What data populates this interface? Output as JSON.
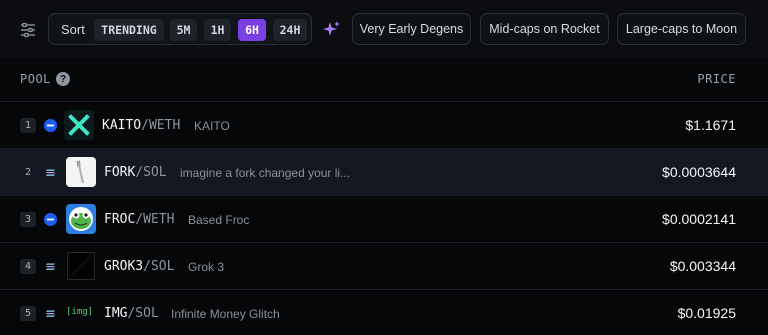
{
  "toolbar": {
    "sort_label": "Sort",
    "sort_options": [
      {
        "label": "TRENDING",
        "active": false
      },
      {
        "label": "5M",
        "active": false
      },
      {
        "label": "1H",
        "active": false
      },
      {
        "label": "6H",
        "active": true
      },
      {
        "label": "24H",
        "active": false
      }
    ],
    "presets": [
      "Very Early Degens",
      "Mid-caps on Rocket",
      "Large-caps to Moon"
    ],
    "accent_color": "#7b3fe4"
  },
  "table": {
    "pool_header": "POOL",
    "help_glyph": "?",
    "price_header": "PRICE",
    "rows": [
      {
        "rank": "1",
        "chain_icon": "base-chain-icon",
        "logo": "kaito-logo",
        "base": "KAITO",
        "quote": "/WETH",
        "name": "KAITO",
        "price": "$1.1671",
        "highlighted": false
      },
      {
        "rank": "2",
        "chain_icon": "solana-chain-icon",
        "logo": "fork-logo",
        "base": "FORK",
        "quote": "/SOL",
        "name": "imagine a fork changed your li...",
        "price": "$0.0003644",
        "highlighted": true
      },
      {
        "rank": "3",
        "chain_icon": "base-chain-icon",
        "logo": "froc-logo",
        "base": "FROC",
        "quote": "/WETH",
        "name": "Based Froc",
        "price": "$0.0002141",
        "highlighted": false
      },
      {
        "rank": "4",
        "chain_icon": "solana-chain-icon",
        "logo": "grok3-logo",
        "base": "GROK3",
        "quote": "/SOL",
        "name": "Grok 3",
        "price": "$0.003344",
        "highlighted": false
      },
      {
        "rank": "5",
        "chain_icon": "solana-chain-icon",
        "logo": "img-broken-logo",
        "logo_text": "[img]",
        "base": "IMG",
        "quote": "/SOL",
        "name": "Infinite Money Glitch",
        "price": "$0.01925",
        "highlighted": false
      }
    ]
  }
}
